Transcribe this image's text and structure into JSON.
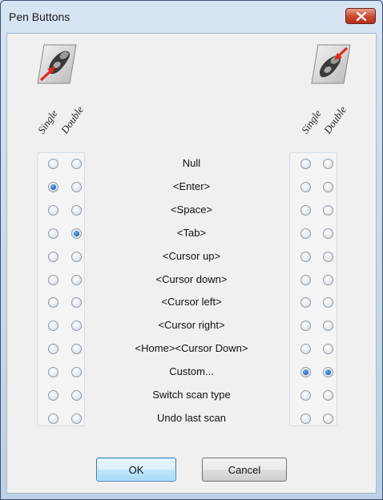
{
  "window": {
    "title": "Pen Buttons"
  },
  "columns": {
    "left": {
      "single_label": "Single",
      "double_label": "Double"
    },
    "right": {
      "single_label": "Single",
      "double_label": "Double"
    }
  },
  "actions": [
    {
      "label": "Null",
      "left_single": false,
      "left_double": false,
      "right_single": false,
      "right_double": false
    },
    {
      "label": "<Enter>",
      "left_single": true,
      "left_double": false,
      "right_single": false,
      "right_double": false
    },
    {
      "label": "<Space>",
      "left_single": false,
      "left_double": false,
      "right_single": false,
      "right_double": false
    },
    {
      "label": "<Tab>",
      "left_single": false,
      "left_double": true,
      "right_single": false,
      "right_double": false
    },
    {
      "label": "<Cursor up>",
      "left_single": false,
      "left_double": false,
      "right_single": false,
      "right_double": false
    },
    {
      "label": "<Cursor down>",
      "left_single": false,
      "left_double": false,
      "right_single": false,
      "right_double": false
    },
    {
      "label": "<Cursor left>",
      "left_single": false,
      "left_double": false,
      "right_single": false,
      "right_double": false
    },
    {
      "label": "<Cursor right>",
      "left_single": false,
      "left_double": false,
      "right_single": false,
      "right_double": false
    },
    {
      "label": "<Home><Cursor Down>",
      "left_single": false,
      "left_double": false,
      "right_single": false,
      "right_double": false
    },
    {
      "label": "Custom...",
      "left_single": false,
      "left_double": false,
      "right_single": true,
      "right_double": true
    },
    {
      "label": "Switch scan type",
      "left_single": false,
      "left_double": false,
      "right_single": false,
      "right_double": false
    },
    {
      "label": "Undo last scan",
      "left_single": false,
      "left_double": false,
      "right_single": false,
      "right_double": false
    }
  ],
  "buttons": {
    "ok_label": "OK",
    "cancel_label": "Cancel"
  },
  "icons": {
    "left": "pen-bottom-button-icon",
    "right": "pen-top-button-icon",
    "close": "close-icon"
  },
  "colors": {
    "radio_checked": "#1a5fb4",
    "arrow": "#e0261b"
  }
}
